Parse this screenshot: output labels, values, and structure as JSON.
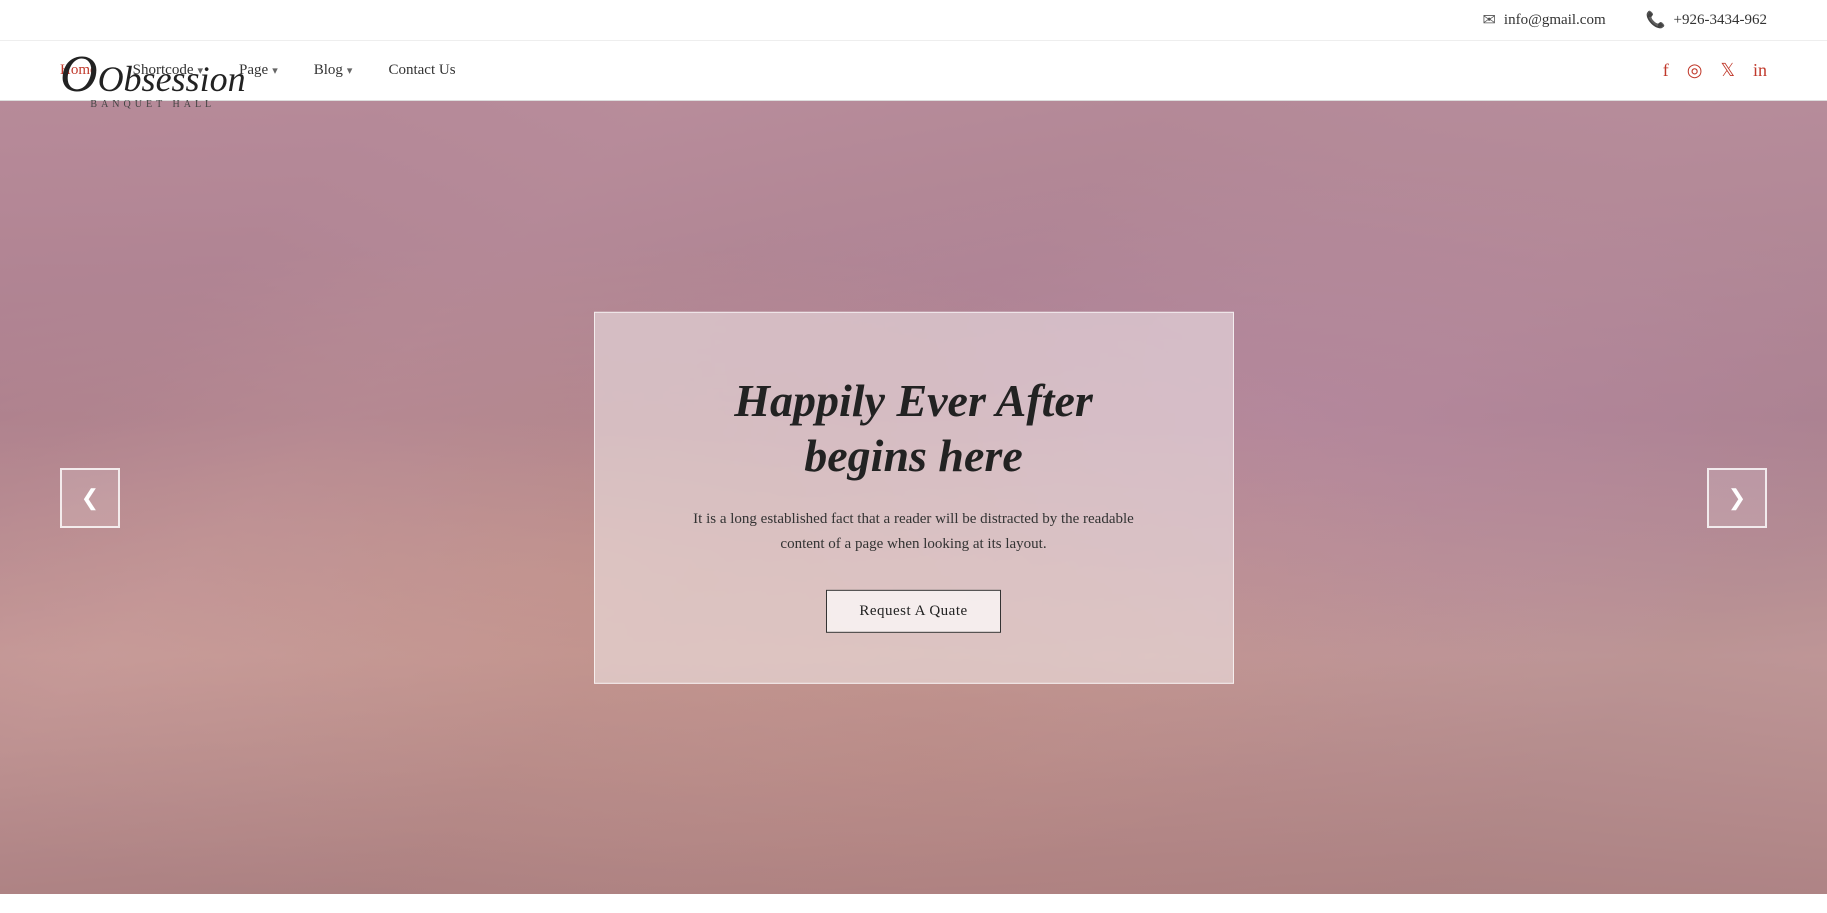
{
  "topbar": {
    "email_icon": "✉",
    "email": "info@gmail.com",
    "phone_icon": "📞",
    "phone": "+926-3434-962"
  },
  "logo": {
    "main": "Obsession",
    "sub": "Banquet Hall"
  },
  "nav": {
    "home": "Home",
    "shortcode": "Shortcode",
    "page": "Page",
    "blog": "Blog",
    "contact": "Contact Us"
  },
  "social": {
    "facebook": "f",
    "instagram": "◎",
    "twitter": "𝕏",
    "linkedin": "in"
  },
  "hero": {
    "title": "Happily Ever After begins here",
    "subtitle": "It is a long established fact that a reader will be distracted by the readable content of a page when looking at its layout.",
    "cta_label": "Request A Quate",
    "prev_arrow": "❮",
    "next_arrow": "❯"
  }
}
